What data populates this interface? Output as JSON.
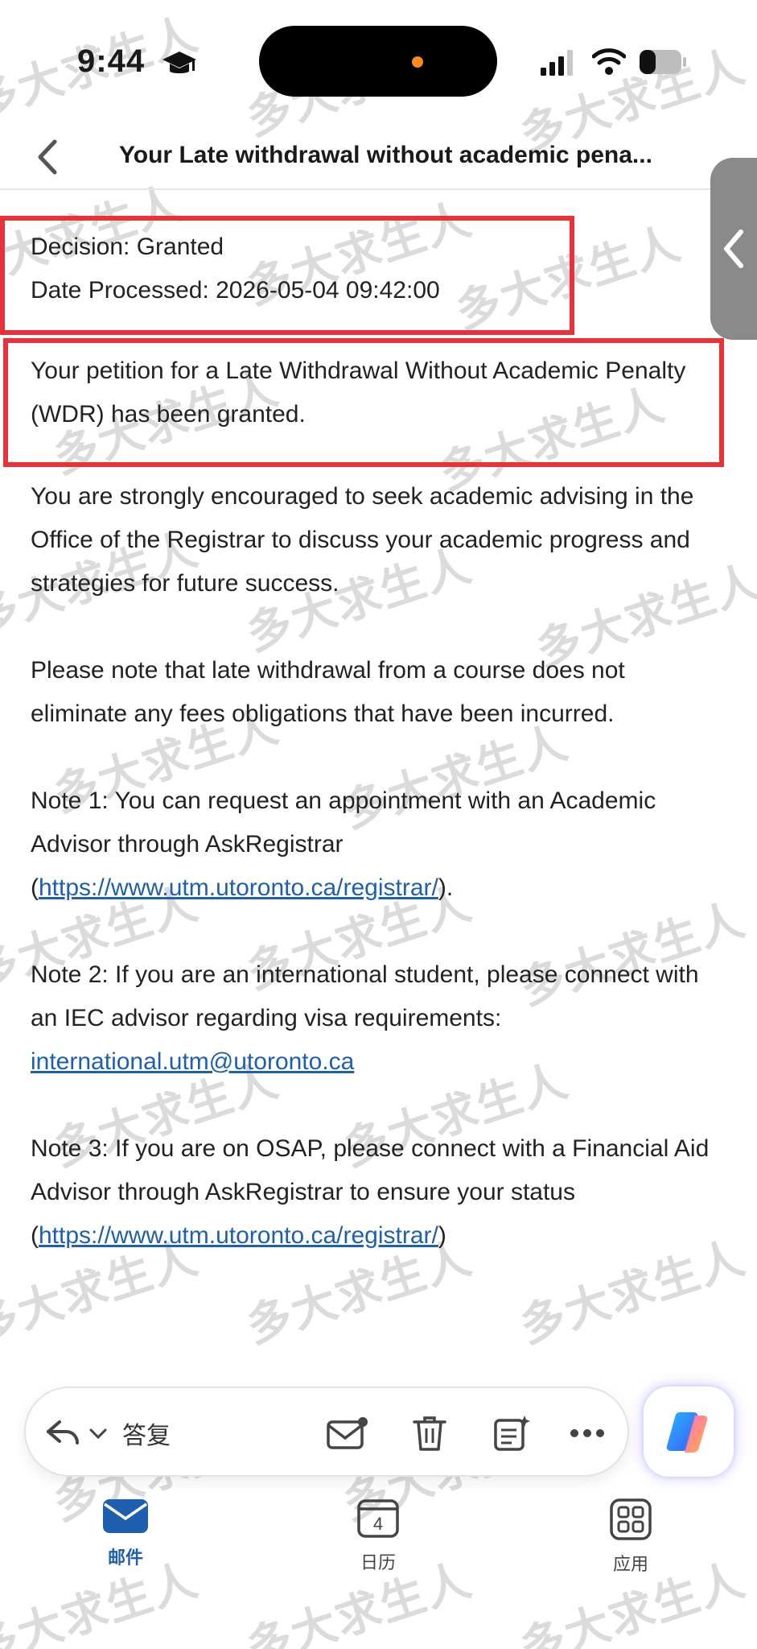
{
  "status_bar": {
    "time": "9:44"
  },
  "header": {
    "subject": "Your Late withdrawal without academic pena..."
  },
  "email": {
    "decision": "Decision: Granted",
    "date_processed": "Date Processed: 2026-05-04 09:42:00",
    "granted_text": "Your petition for a Late Withdrawal Without Academic Penalty (WDR) has been granted.",
    "advising_text": "You are strongly encouraged to seek academic advising in the Office of the Registrar to discuss your academic progress and strategies for future success.",
    "fees_text": "Please note that late withdrawal from a course does not eliminate any fees obligations that have been incurred.",
    "note1_prefix": "Note 1: You can request an appointment with an Academic Advisor through AskRegistrar (",
    "note1_link": "https://www.utm.utoronto.ca/registrar/",
    "note1_suffix": ").",
    "note2_prefix": "Note 2: If you are an international student, please connect with an IEC advisor regarding visa requirements: ",
    "note2_link": "international.utm@utoronto.ca",
    "note3_prefix": "Note 3: If you are on OSAP, please connect with a Financial Aid Advisor through AskRegistrar to ensure your status (",
    "note3_link": "https://www.utm.utoronto.ca/registrar/",
    "note3_suffix": ")"
  },
  "watermark": "多大求生人",
  "toolbar": {
    "reply_label": "答复"
  },
  "tabs": [
    {
      "label": "邮件"
    },
    {
      "label": "日历",
      "date": "4"
    },
    {
      "label": "应用"
    }
  ],
  "colors": {
    "accent": "#1f5fb0",
    "highlight_box": "#e8323a"
  }
}
